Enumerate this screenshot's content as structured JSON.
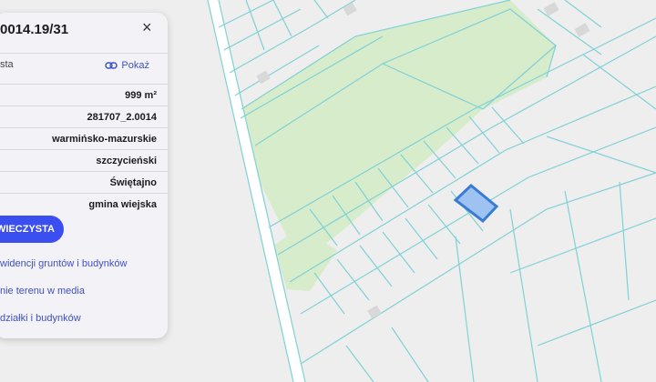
{
  "map": {
    "colors": {
      "background": "#eeeeee",
      "forest": "#d6eccb",
      "parcel_line": "#7fd1d6",
      "selected_fill": "#9ec3f2",
      "selected_stroke": "#3a7bd5",
      "road": "#ffffff",
      "building": "#d8d8d8"
    }
  },
  "panel": {
    "title": "0014.19/31",
    "close_icon": "×",
    "source_label": "sta",
    "show_link": "Pokaż",
    "rows": [
      {
        "label": "",
        "value": "999 m²"
      },
      {
        "label": "",
        "value": "281707_2.0014"
      },
      {
        "label": "",
        "value": "warmińsko-mazurskie"
      },
      {
        "label": "",
        "value": "szczycieński"
      },
      {
        "label": "",
        "value": "Świętajno"
      },
      {
        "label": "",
        "value": "gmina wiejska"
      }
    ],
    "pill_button": "WIECZYSTA",
    "links": [
      "widencji gruntów i budynków",
      "nie terenu w media",
      "działki i budynków"
    ]
  }
}
